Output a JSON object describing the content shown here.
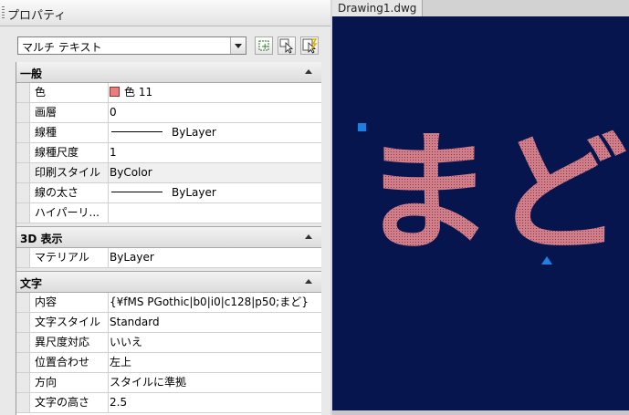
{
  "palette": {
    "title": "プロパティ",
    "object_type": "マルチ テキスト",
    "toolbar_icons": [
      "toggle-pickadd-icon",
      "select-objects-icon",
      "quick-select-icon"
    ]
  },
  "sections": {
    "general": {
      "header": "一般",
      "rows": [
        {
          "name": "色",
          "value": "色 11"
        },
        {
          "name": "画層",
          "value": "0"
        },
        {
          "name": "線種",
          "value": "ByLayer"
        },
        {
          "name": "線種尺度",
          "value": "1"
        },
        {
          "name": "印刷スタイル",
          "value": "ByColor"
        },
        {
          "name": "線の太さ",
          "value": "ByLayer"
        },
        {
          "name": "ハイパーリ...",
          "value": ""
        }
      ]
    },
    "display3d": {
      "header": "3D 表示",
      "rows": [
        {
          "name": "マテリアル",
          "value": "ByLayer"
        }
      ]
    },
    "text": {
      "header": "文字",
      "rows": [
        {
          "name": "内容",
          "value": "{¥fMS PGothic|b0|i0|c128|p50;まど}"
        },
        {
          "name": "文字スタイル",
          "value": "Standard"
        },
        {
          "name": "異尺度対応",
          "value": "いいえ"
        },
        {
          "name": "位置合わせ",
          "value": "左上"
        },
        {
          "name": "方向",
          "value": "スタイルに準拠"
        },
        {
          "name": "文字の高さ",
          "value": "2.5"
        }
      ]
    }
  },
  "drawing": {
    "tab_label": "Drawing1.dwg",
    "text": "まど",
    "colors": {
      "background": "#07154f",
      "text_fill": "#d07f8a",
      "grip": "#1f7fe0"
    }
  }
}
